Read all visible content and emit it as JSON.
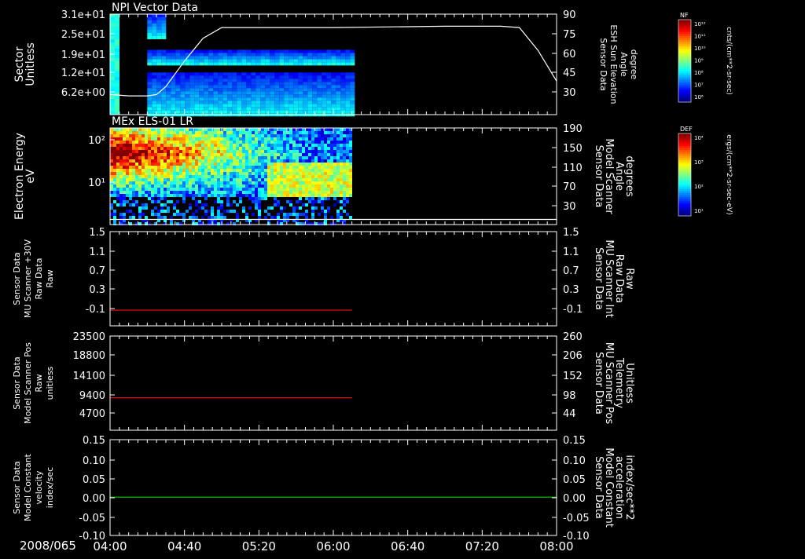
{
  "date_label": "2008/065",
  "x_axis": {
    "range": [
      "04:00",
      "08:00"
    ],
    "tick_labels": [
      "04:00",
      "04:40",
      "05:20",
      "06:00",
      "06:40",
      "07:20",
      "08:00"
    ]
  },
  "colors": {
    "background": "#000000",
    "axes": "#ffffff",
    "red_series": "#e01010",
    "green_series": "#10d010"
  },
  "colorbars": [
    {
      "label": "NF",
      "units": "cnts/(cm**2-sr-sec)",
      "tick_labels": [
        "10¹²",
        "10¹¹",
        "10¹⁰",
        "10⁹",
        "10⁸",
        "10⁷",
        "10⁶"
      ]
    },
    {
      "label": "DEF",
      "units": "ergs/(cm**2-sr-sec-eV)",
      "tick_labels": [
        "10⁴",
        "10³",
        "10²",
        "10¹"
      ]
    }
  ],
  "chart_data": [
    {
      "type": "heatmap",
      "title": "NPI Vector Data",
      "ylabel": [
        "Sector",
        "Unitless"
      ],
      "y_tick_labels": [
        "3.1e+01",
        "2.5e+01",
        "1.9e+01",
        "1.2e+01",
        "6.2e+00"
      ],
      "ylim": [
        0,
        31
      ],
      "heat_segments": [
        {
          "start": "04:00",
          "end": "04:05",
          "ymin": 0,
          "ymax": 31
        },
        {
          "start": "04:20",
          "end": "06:10",
          "ymin": 0,
          "ymax": 13
        },
        {
          "start": "04:20",
          "end": "06:10",
          "ymin": 16,
          "ymax": 20
        },
        {
          "start": "04:20",
          "end": "04:30",
          "ymin": 24,
          "ymax": 31
        }
      ],
      "overlay_series": {
        "ylabel": [
          "Sensor Data",
          "ESH Sun Elevation",
          "Angle",
          "degree"
        ],
        "y2_tick_labels": [
          "90",
          "75",
          "60",
          "45",
          "30"
        ],
        "y2lim": [
          15,
          90
        ],
        "color": "#ffffff",
        "x": [
          "04:00",
          "04:10",
          "04:20",
          "04:25",
          "04:30",
          "04:40",
          "04:50",
          "05:00",
          "06:00",
          "07:00",
          "07:30",
          "07:40",
          "07:50",
          "08:00"
        ],
        "values": [
          30,
          29,
          29,
          30,
          36,
          55,
          72,
          80,
          80,
          81,
          81,
          80,
          63,
          40
        ]
      }
    },
    {
      "type": "heatmap",
      "title": "MEx ELS-01 LR",
      "ylabel": [
        "Electron Energy",
        "eV"
      ],
      "y_tick_labels": [
        "10²",
        "10¹"
      ],
      "yscale": "log",
      "ylim": [
        1,
        180
      ],
      "heat_segments": [
        {
          "start": "04:00",
          "end": "06:10",
          "ymin": 1,
          "ymax": 180
        }
      ],
      "overlay_series": {
        "ylabel": [
          "Sensor Data",
          "Model Scanner",
          "Angle",
          "degrees"
        ],
        "y2_tick_labels": [
          "190",
          "150",
          "110",
          "70",
          "30"
        ],
        "y2lim": [
          0,
          190
        ],
        "color": "#ffffff",
        "x": [
          "04:00",
          "08:00"
        ],
        "values": [
          10,
          10
        ]
      }
    },
    {
      "type": "line",
      "ylabel": [
        "Sensor Data",
        "MU Scanner +30V",
        "Raw Data",
        "Raw"
      ],
      "y_tick_labels": [
        "1.5",
        "1.1",
        "0.7",
        "0.3",
        "-0.1"
      ],
      "ylim": [
        -0.3,
        1.5
      ],
      "y2label": [
        "Sensor Data",
        "MU Scanner Int",
        "Raw Data",
        "Raw"
      ],
      "y2_tick_labels": [
        "1.5",
        "1.1",
        "0.7",
        "0.3",
        "-0.1"
      ],
      "series": [
        {
          "color": "#e01010",
          "x": [
            "04:00",
            "06:10"
          ],
          "values": [
            0.0,
            0.0
          ]
        }
      ]
    },
    {
      "type": "line",
      "ylabel": [
        "Sensor Data",
        "Model Scanner Pos",
        "Raw",
        "unitless"
      ],
      "y_tick_labels": [
        "23500",
        "18800",
        "14100",
        "9400",
        "4700"
      ],
      "ylim": [
        0,
        23500
      ],
      "y2label": [
        "Sensor Data",
        "MU Scanner Pos",
        "Telemetry",
        "Unitless"
      ],
      "y2_tick_labels": [
        "260",
        "206",
        "152",
        "98",
        "44"
      ],
      "series": [
        {
          "color": "#e01010",
          "x": [
            "04:00",
            "06:10"
          ],
          "values": [
            8100,
            8100
          ]
        }
      ]
    },
    {
      "type": "line",
      "ylabel": [
        "Sensor Data",
        "Model Constant",
        "velocity",
        "index/sec"
      ],
      "y_tick_labels": [
        "0.15",
        "0.10",
        "0.05",
        "0.00",
        "-0.05",
        "-0.10"
      ],
      "ylim": [
        -0.1,
        0.15
      ],
      "y2label": [
        "Sensor Data",
        "Model Constant",
        "acceleration",
        "index/sec**2"
      ],
      "y2_tick_labels": [
        "0.15",
        "0.10",
        "0.05",
        "0.00",
        "-0.05",
        "-0.10"
      ],
      "series": [
        {
          "color": "#10d010",
          "x": [
            "04:00",
            "08:00"
          ],
          "values": [
            0.0,
            0.0
          ]
        }
      ]
    }
  ]
}
